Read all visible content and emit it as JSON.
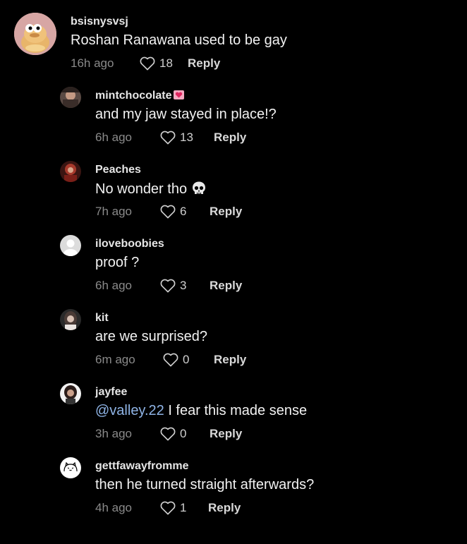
{
  "top_comment": {
    "username": "bsisnysvsj",
    "text": "Roshan Ranawana used to be gay",
    "time": "16h ago",
    "likes": "18",
    "reply_label": "Reply",
    "avatar": "cartoon-character-icon"
  },
  "replies": [
    {
      "username": "mintchocolate",
      "username_emoji": "heart-emoji-icon",
      "text": "and my jaw stayed in place!?",
      "time": "6h ago",
      "likes": "13",
      "reply_label": "Reply"
    },
    {
      "username": "Peaches",
      "text": "No wonder tho",
      "text_emoji": "skull-emoji-icon",
      "time": "7h ago",
      "likes": "6",
      "reply_label": "Reply"
    },
    {
      "username": "iloveboobies",
      "text": "proof ?",
      "time": "6h ago",
      "likes": "3",
      "reply_label": "Reply"
    },
    {
      "username": "kit",
      "text": "are we surprised?",
      "time": "6m ago",
      "likes": "0",
      "reply_label": "Reply"
    },
    {
      "username": "jayfee",
      "mention": "@valley.22",
      "text": " I fear this made sense",
      "time": "3h ago",
      "likes": "0",
      "reply_label": "Reply"
    },
    {
      "username": "gettfawayfromme",
      "text": "then he turned straight afterwards?",
      "time": "4h ago",
      "likes": "1",
      "reply_label": "Reply"
    }
  ],
  "colors": {
    "background": "#000000",
    "mention": "#8fb4e6",
    "timestamp": "#8a8a8a"
  }
}
